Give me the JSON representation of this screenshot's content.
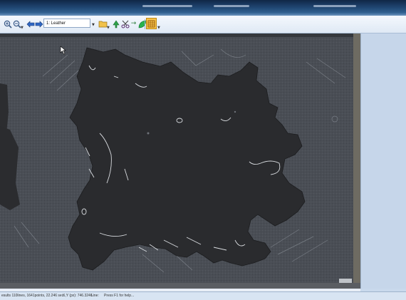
{
  "toolbar": {
    "layer_select_value": "1: Leather",
    "icons": [
      "zoom-in-icon",
      "zoom-out-icon",
      "back-arrow-icon",
      "forward-arrow-icon",
      "folder-icon",
      "tree-icon",
      "scissors-icon",
      "arrow-right-icon",
      "leaf-icon",
      "grid-icon"
    ]
  },
  "status": {
    "results": "esults 110lines, 1641points, 22.246 sec.",
    "xy": "X,Y (px): 746.3246",
    "line": "Line:",
    "hint": "Press F1 for help..."
  },
  "colors": {
    "hide": "#2b2c2e",
    "board": "#474b52",
    "chalk": "#d9dce0"
  }
}
